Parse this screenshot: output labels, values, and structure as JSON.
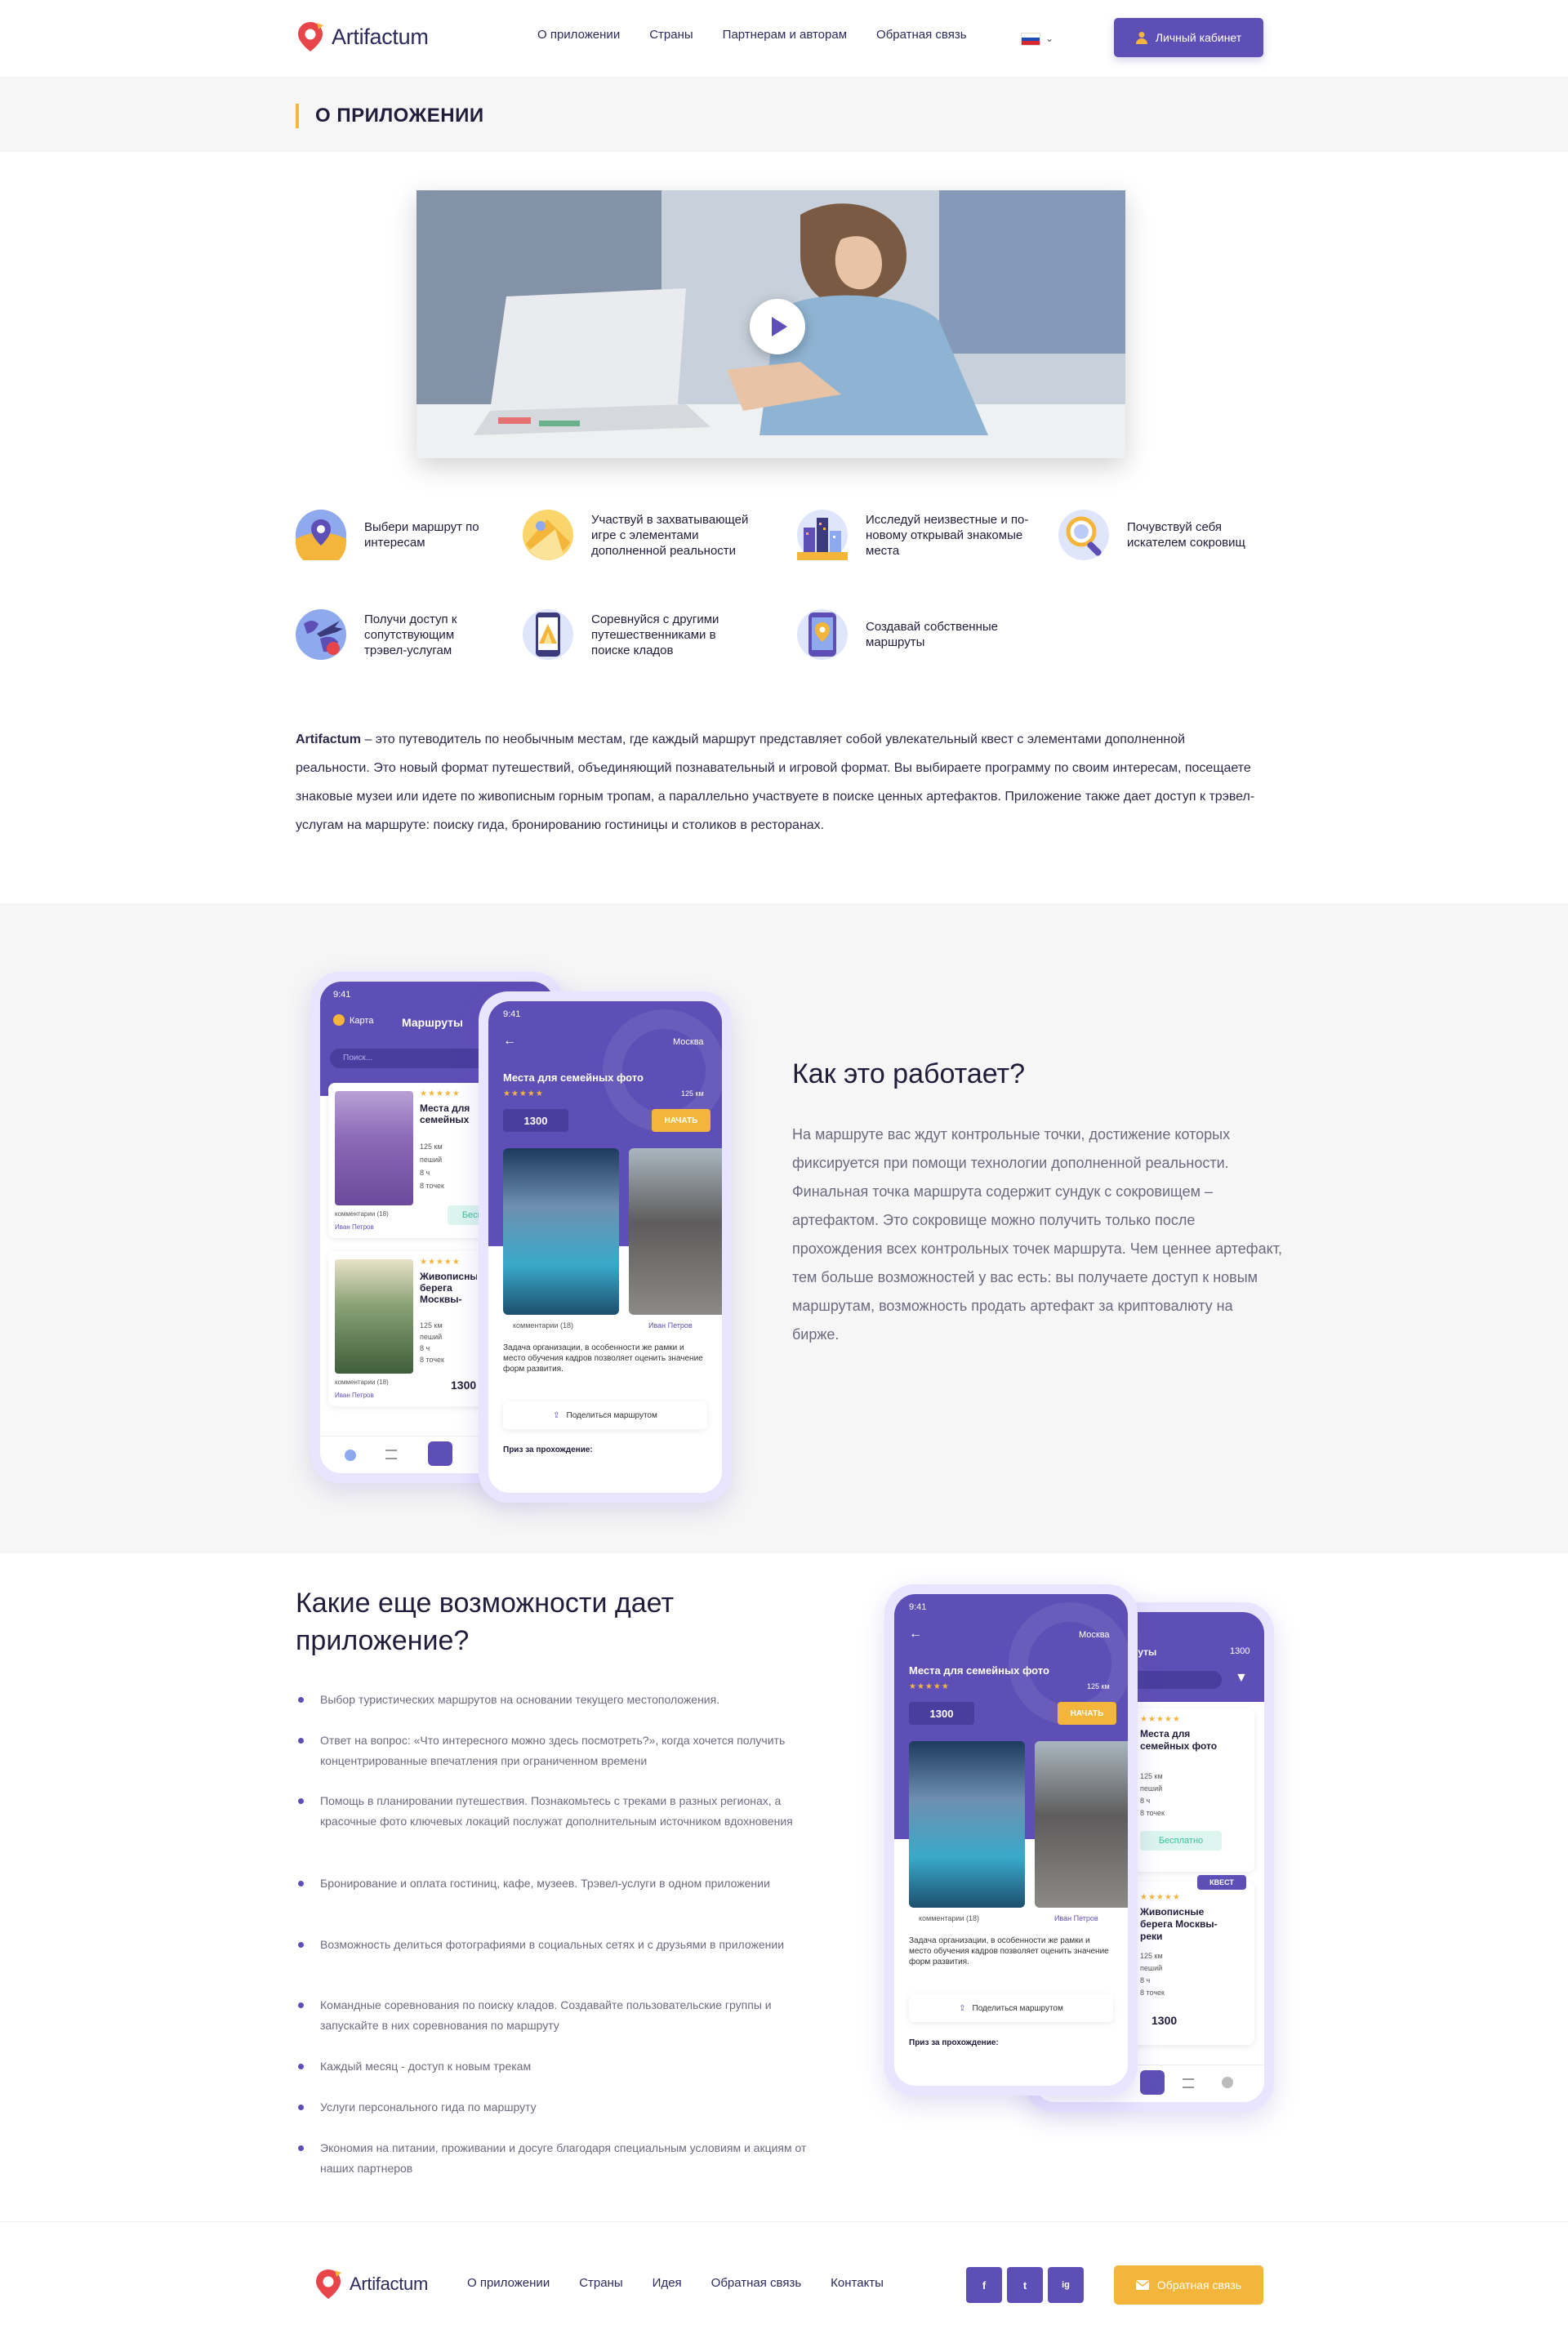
{
  "header": {
    "brand": "Artifactum",
    "nav": [
      "О приложении",
      "Страны",
      "Партнерам и авторам",
      "Обратная связь"
    ],
    "cabinet_label": "Личный кабинет"
  },
  "band": {
    "title": "О ПРИЛОЖЕНИИ"
  },
  "features": [
    "Выбери маршрут по интересам",
    "Участвуй в захватывающей игре с элементами дополненной реальности",
    "Исследуй неизвестные и по-новому открывай знакомые места",
    "Почувствуй себя искателем сокровищ",
    "Получи доступ к сопутствующим трэвел-услугам",
    "Соревнуйся с другими путешественниками в поиске кладов",
    "Создавай собственные маршруты"
  ],
  "about": {
    "brand": "Artifactum",
    "text": " – это путеводитель по необычным местам, где каждый маршрут представляет собой увлекательный квест с элементами дополненной реальности. Это новый формат путешествий, объединяющий познавательный и игровой формат. Вы выбираете программу по своим интересам, посещаете знаковые музеи или идете по живописным горным тропам, а параллельно участвуете в поиске ценных артефактов. Приложение также дает доступ к трэвел-услугам на маршруте: поиску гида, бронированию гостиницы и столиков в ресторанах."
  },
  "how": {
    "title": "Как это работает?",
    "text": "На маршруте вас ждут контрольные точки, достижение которых фиксируется при помощи технологии дополненной реальности. Финальная точка маршрута содержит сундук с сокровищем – артефактом. Это сокровище можно получить только после прохождения всех контрольных точек маршрута. Чем ценнее артефакт, тем больше возможностей у вас есть: вы получаете доступ к новым маршрутам, возможность продать артефакт за криптовалюту на бирже."
  },
  "app": {
    "time": "9:41",
    "map": "Карта",
    "routes": "Маршруты",
    "search": "Поиск...",
    "city": "Москва",
    "route_title": "Места для семейных фото",
    "distance": "125",
    "distance_unit": "км",
    "price": "1300",
    "start": "НАЧАТЬ",
    "comments": "комментарии (18)",
    "author": "Иван Петров",
    "desc": "Задача организации, в особенности же рамки и место обучения кадров позволяет оценить значение форм развития.",
    "share": "Поделиться маршрутом",
    "prize": "Приз за прохождение:",
    "card1_title": "Места для семейных фото",
    "card2_title": "Живописные берега Москвы-реки",
    "walk": "пеший",
    "hours": "8 ч",
    "points": "8 точек",
    "free": "Бесплатно",
    "quest": "КВЕСТ"
  },
  "more": {
    "title": "Какие еще возможности дает приложение?",
    "items": [
      "Выбор туристических маршрутов на основании текущего местоположения.",
      "Ответ на вопрос: «Что интересного можно здесь посмотреть?», когда хочется получить концентрированные впечатления при ограниченном времени",
      "Помощь в планировании путешествия. Познакомьтесь с треками в разных регионах, а красочные фото ключевых локаций послужат дополнительным источником вдохновения",
      "Бронирование и оплата гостиниц, кафе, музеев. Трэвел-услуги в одном приложении",
      "Возможность делиться фотографиями в социальных сетях и с друзьями в приложении",
      "Командные соревнования по поиску кладов. Создавайте пользовательские группы и запускайте в них соревнования по маршруту",
      "Каждый месяц - доступ к новым трекам",
      "Услуги персонального гида по маршруту",
      "Экономия на питании, проживании и досуге благодаря специальным условиям и акциям от наших партнеров"
    ]
  },
  "footer": {
    "brand": "Artifactum",
    "nav": [
      "О приложении",
      "Страны",
      "Идея",
      "Обратная связь",
      "Контакты"
    ],
    "social": [
      "f",
      "t",
      "ig"
    ],
    "feedback_label": "Обратная связь"
  },
  "colors": {
    "accent": "#5e4fb6",
    "yellow": "#f4b63a"
  }
}
